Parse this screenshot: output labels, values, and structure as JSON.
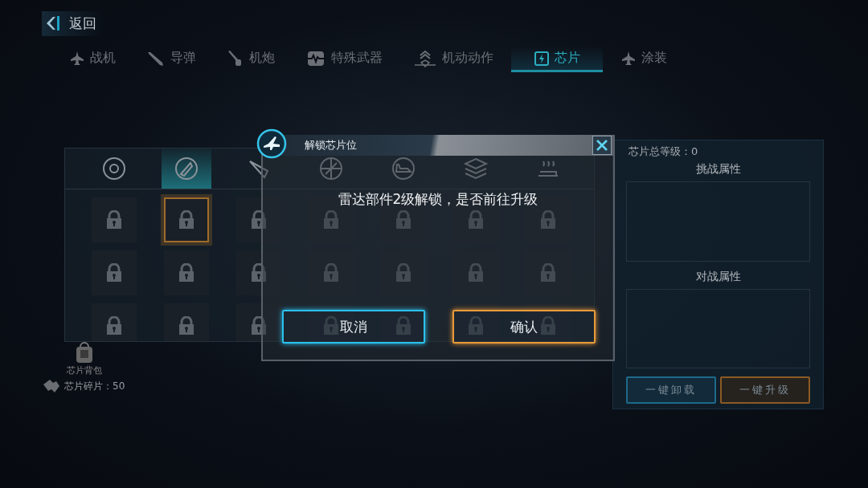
{
  "back_button": {
    "label": "返回"
  },
  "tabs": [
    {
      "label": "战机",
      "selected": false
    },
    {
      "label": "导弹",
      "selected": false
    },
    {
      "label": "机炮",
      "selected": false
    },
    {
      "label": "特殊武器",
      "selected": false
    },
    {
      "label": "机动动作",
      "selected": false
    },
    {
      "label": "芯片",
      "selected": true
    },
    {
      "label": "涂装",
      "selected": false
    }
  ],
  "chip_panel": {
    "categories": [
      {
        "selected": false
      },
      {
        "selected": true
      },
      {
        "selected": false
      },
      {
        "selected": false
      },
      {
        "selected": false
      },
      {
        "selected": false
      },
      {
        "selected": false
      }
    ],
    "slots": [
      {
        "locked": true,
        "selected": false
      },
      {
        "locked": true,
        "selected": true
      },
      {
        "locked": true,
        "selected": false
      },
      {
        "locked": true,
        "selected": false
      },
      {
        "locked": true,
        "selected": false
      },
      {
        "locked": true,
        "selected": false
      },
      {
        "locked": true,
        "selected": false
      },
      {
        "locked": true,
        "selected": false
      },
      {
        "locked": true,
        "selected": false
      },
      {
        "locked": true,
        "selected": false
      },
      {
        "locked": true,
        "selected": false
      },
      {
        "locked": true,
        "selected": false
      },
      {
        "locked": true,
        "selected": false
      },
      {
        "locked": true,
        "selected": false
      },
      {
        "locked": true,
        "selected": false
      },
      {
        "locked": true,
        "selected": false
      },
      {
        "locked": true,
        "selected": false
      },
      {
        "locked": true,
        "selected": false
      },
      {
        "locked": true,
        "selected": false
      },
      {
        "locked": true,
        "selected": false
      },
      {
        "locked": true,
        "selected": false
      }
    ]
  },
  "backpack": {
    "label": "芯片背包"
  },
  "fragments": {
    "label": "芯片碎片：50"
  },
  "stats_panel": {
    "total_level": "芯片总等级：0",
    "challenge_heading": "挑战属性",
    "battle_heading": "对战属性",
    "buttons": [
      {
        "label": "一键卸载",
        "kind": "blue"
      },
      {
        "label": "一键升级",
        "kind": "orange"
      }
    ]
  },
  "dialog": {
    "title": "解锁芯片位",
    "message": "雷达部件2级解锁，是否前往升级",
    "buttons": [
      {
        "label": "取消",
        "kind": "blue"
      },
      {
        "label": "确认",
        "kind": "orange"
      }
    ]
  }
}
